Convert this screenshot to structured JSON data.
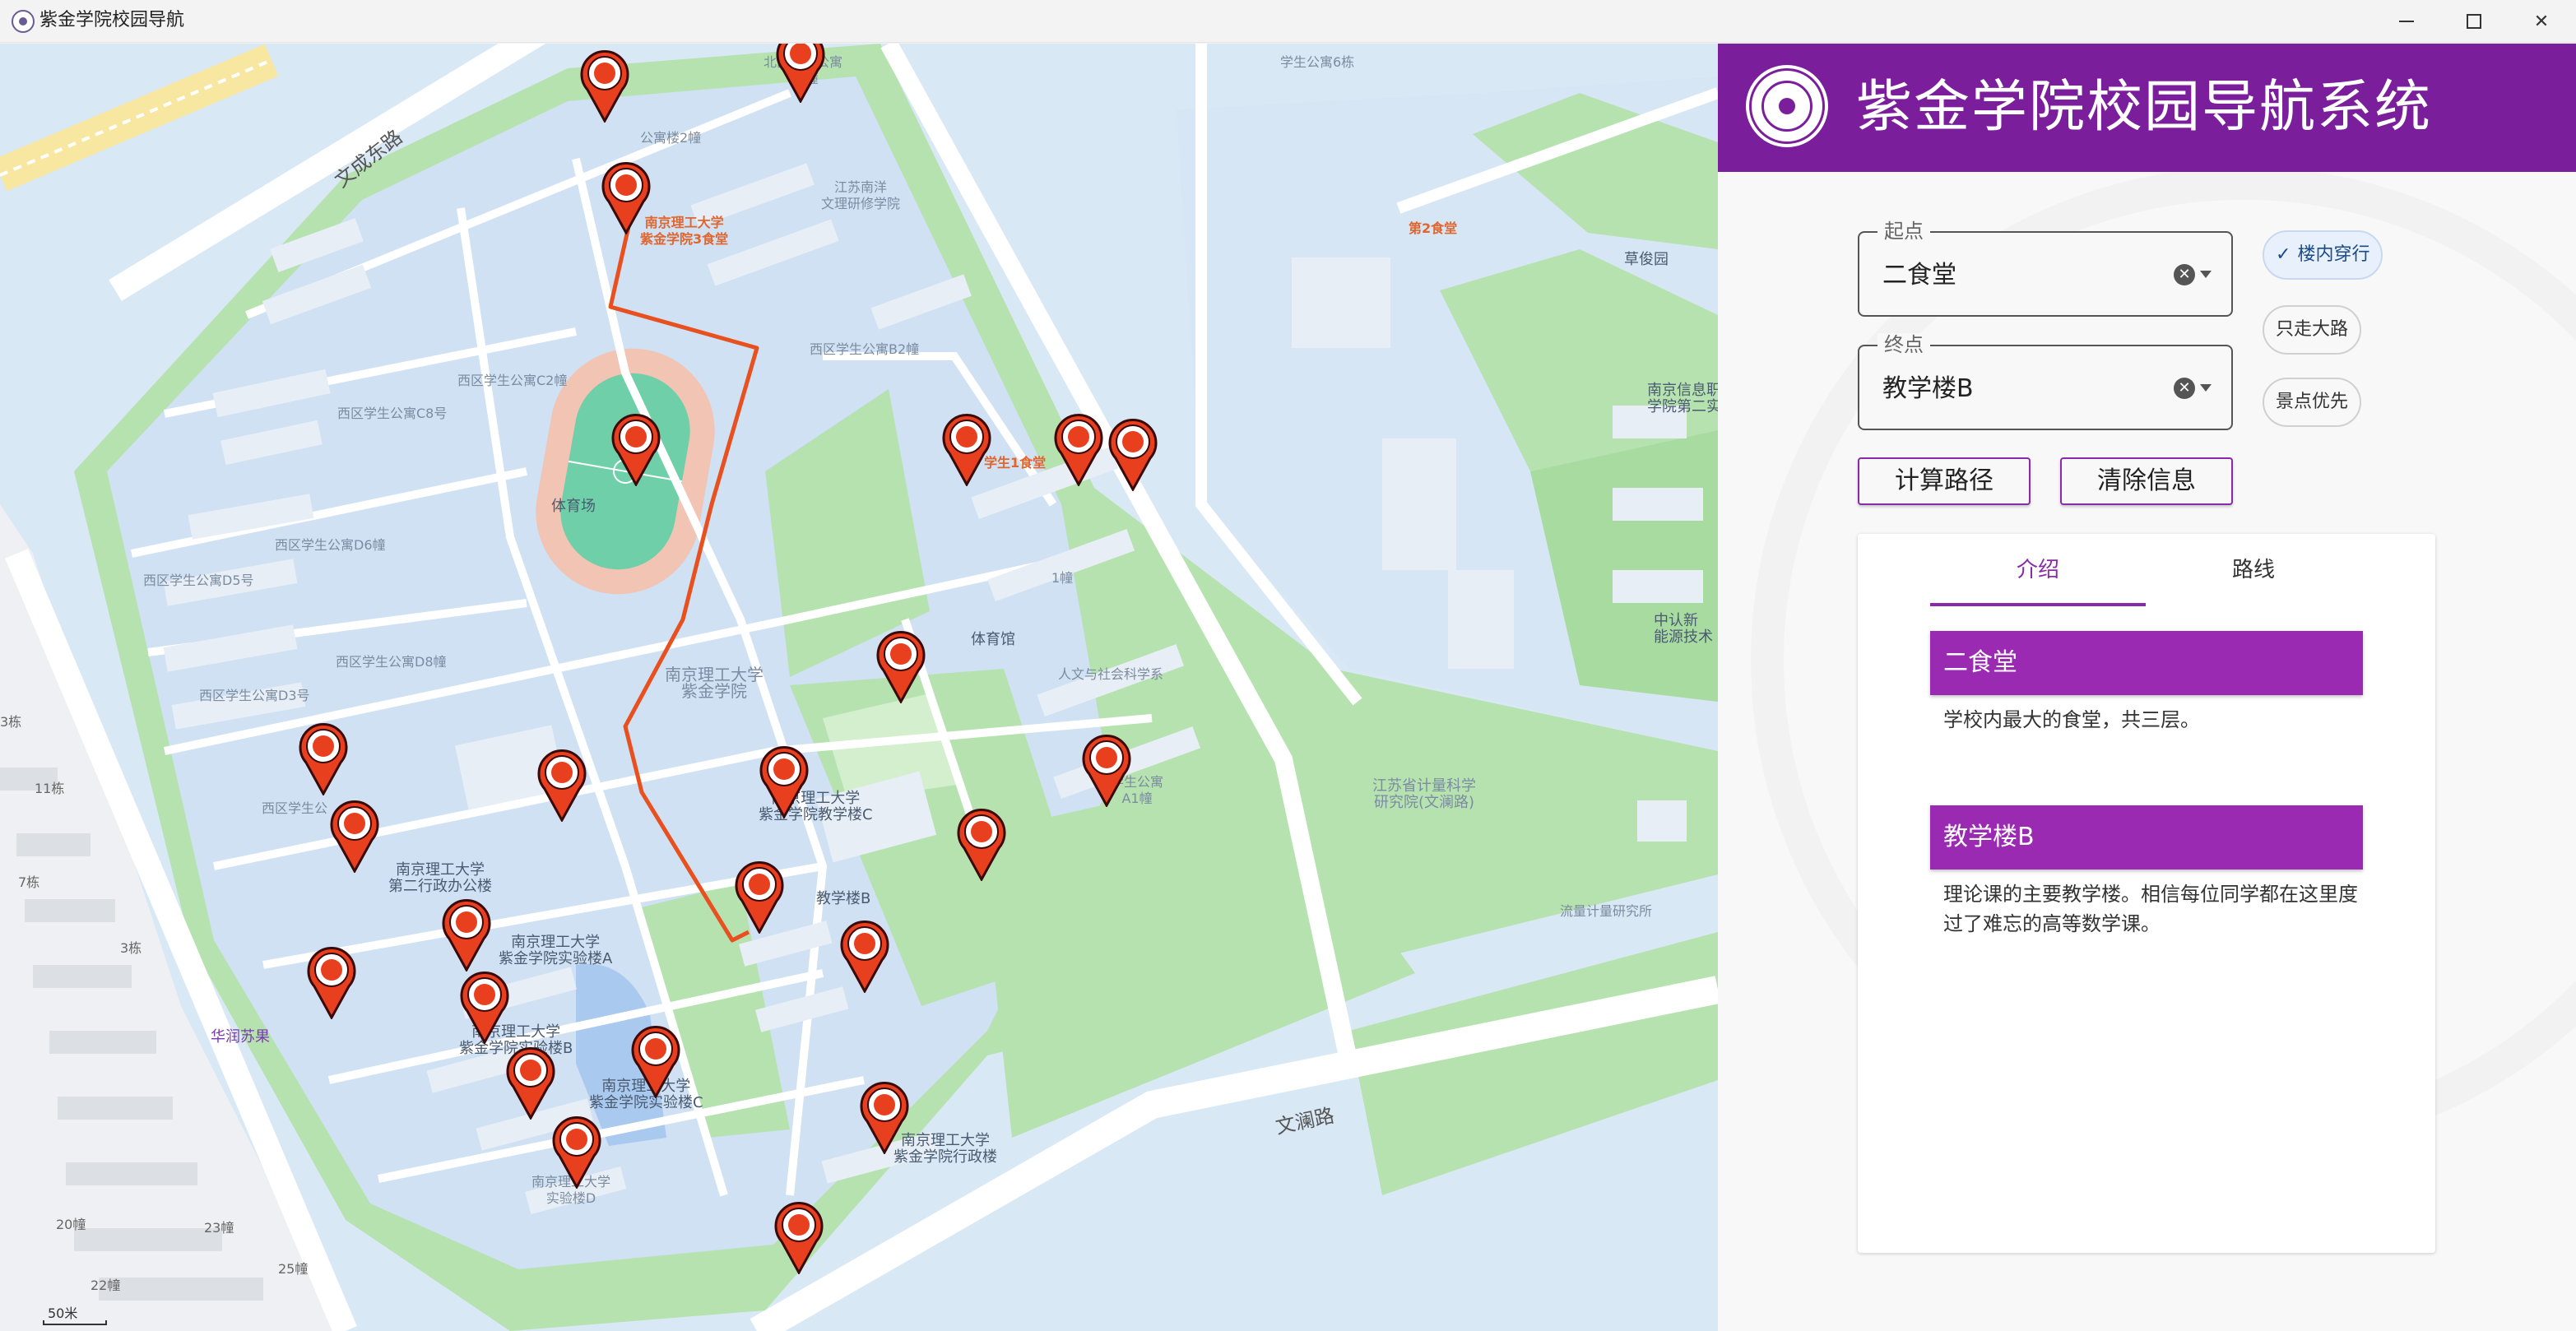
{
  "window": {
    "title": "紫金学院校园导航"
  },
  "header": {
    "title": "紫金学院校园导航系统"
  },
  "form": {
    "start_legend": "起点",
    "start_value": "二食堂",
    "end_legend": "终点",
    "end_value": "教学楼B",
    "clear_icon": "x-circle-icon"
  },
  "options": {
    "indoor": "楼内穿行",
    "main_road": "只走大路",
    "scenic": "景点优先",
    "indoor_selected": true
  },
  "buttons": {
    "calculate": "计算路径",
    "clear": "清除信息"
  },
  "tabs": {
    "intro": "介绍",
    "route": "路线",
    "active": "intro"
  },
  "info": {
    "start_name": "二食堂",
    "start_desc": "学校内最大的食堂，共三层。",
    "end_name": "教学楼B",
    "end_desc": "理论课的主要教学楼。相信每位同学都在这里度过了难忘的高等数学课。"
  },
  "map": {
    "labels": {
      "road_wencheng": "文成东路",
      "road_wenlan": "文澜路",
      "canteen3": "南京理工大学\n紫金学院3食堂",
      "canteen1": "学生1食堂",
      "canteen2": "第2食堂",
      "gym": "体育馆",
      "stadium": "体育场",
      "campus": "南京理工大学\n紫金学院",
      "teaching_c": "南京理工大学\n紫金学院教学楼C",
      "teaching_b": "教学楼B",
      "admin2": "南京理工大学\n第二行政办公楼",
      "lab_a": "南京理工大学\n紫金学院实验楼A",
      "lab_b": "南京理工大学\n紫金学院实验楼B",
      "lab_c": "南京理工大学\n紫金学院实验楼C",
      "lab_d": "南京理工大学\n实验楼D",
      "admin": "南京理工大学\n紫金学院行政楼",
      "humanities": "人文与社会科学系",
      "jiangsu_institute": "江苏南洋\n文理研修学院",
      "metrology": "江苏省计量科学\n研究院(文澜路)",
      "metrology_lab": "流量计量研究所",
      "apt2": "公寓楼2幢",
      "b1": "北区学生公寓\nB1幢",
      "apt6": "学生公寓6栋",
      "west_b2": "西区学生公寓B2幢",
      "west_c2": "西区学生公寓C2幢",
      "west_c8": "西区学生公寓C8号",
      "west_d6": "西区学生公寓D6幢",
      "west_d5": "西区学生公寓D5号",
      "west_d8": "西区学生公寓D8幢",
      "west_d3": "西区学生公寓D3号",
      "west_other": "西区学生公",
      "apt_a1": "学生公寓\nA1幢",
      "building1": "1幢",
      "caolu": "草俊园",
      "info_eng": "南京信息职\n学院第二实",
      "zhongke": "中认新\n能源技术",
      "huarun": "华润苏果",
      "b11": "11栋",
      "b7": "7栋",
      "b3": "3栋",
      "b20": "20幢",
      "b23": "23幢",
      "b25": "25幢",
      "b22": "22幢",
      "b3l": "3栋",
      "scale": "50米"
    }
  },
  "colors": {
    "accent": "#7a1e9c",
    "info_header": "#9b2ab3",
    "route": "#e8501f",
    "marker": "#e8401f",
    "map_bg": "#d9e8f5",
    "green": "#a8dba0"
  }
}
